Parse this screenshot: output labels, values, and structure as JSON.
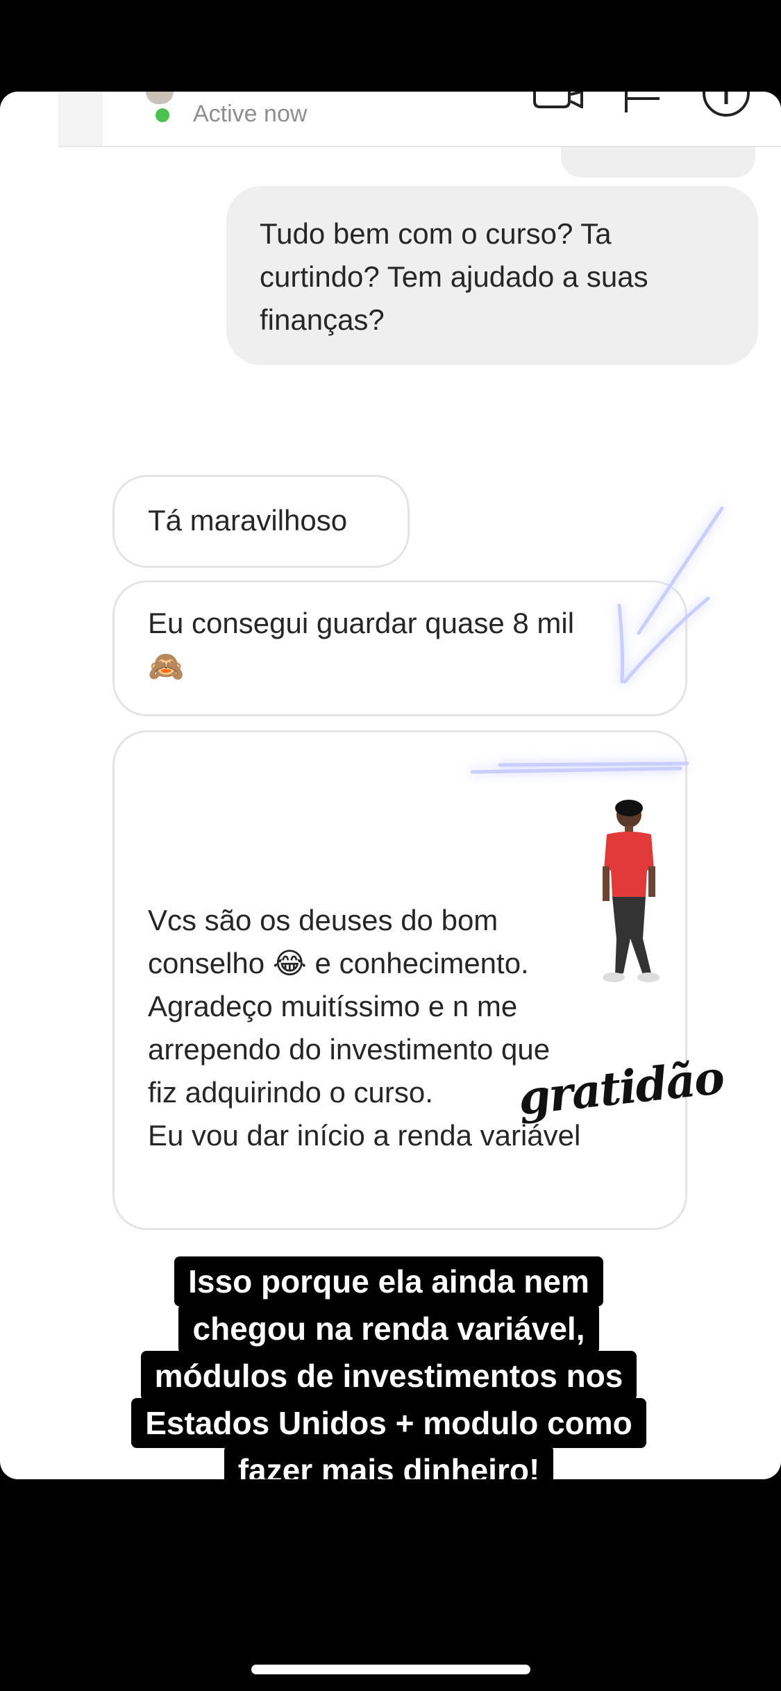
{
  "header": {
    "status_text": "Active now",
    "icons": [
      "video-call-icon",
      "flag-icon",
      "info-icon"
    ]
  },
  "messages": [
    {
      "direction": "sent",
      "lines": [
        "Tudo bem com o curso? Ta",
        "curtindo? Tem ajudado a suas",
        "finanças?"
      ]
    },
    {
      "direction": "received",
      "lines": [
        "Tá maravilhoso"
      ]
    },
    {
      "direction": "received",
      "lines": [
        "Eu consegui guardar quase 8 mil",
        "🙈"
      ]
    },
    {
      "direction": "received",
      "lines": [
        "Vcs são os deuses do bom",
        "conselho 😂 e conhecimento.",
        "Agradeço muitíssimo e n me",
        "arrependo do investimento que",
        "fiz adquirindo o curso.",
        "Eu vou dar início a renda variável"
      ]
    }
  ],
  "sticker_text": "gratidão",
  "caption": {
    "lines": [
      "Isso porque ela ainda nem",
      "chegou na renda variável,",
      "módulos de investimentos nos",
      "Estados Unidos + modulo como",
      "fazer mais dinheiro!"
    ]
  },
  "colors": {
    "active_green": "#4bc24f",
    "sent_bubble": "#efefef",
    "caption_bg": "#000000",
    "arrow_glow": "#7a86ff"
  }
}
